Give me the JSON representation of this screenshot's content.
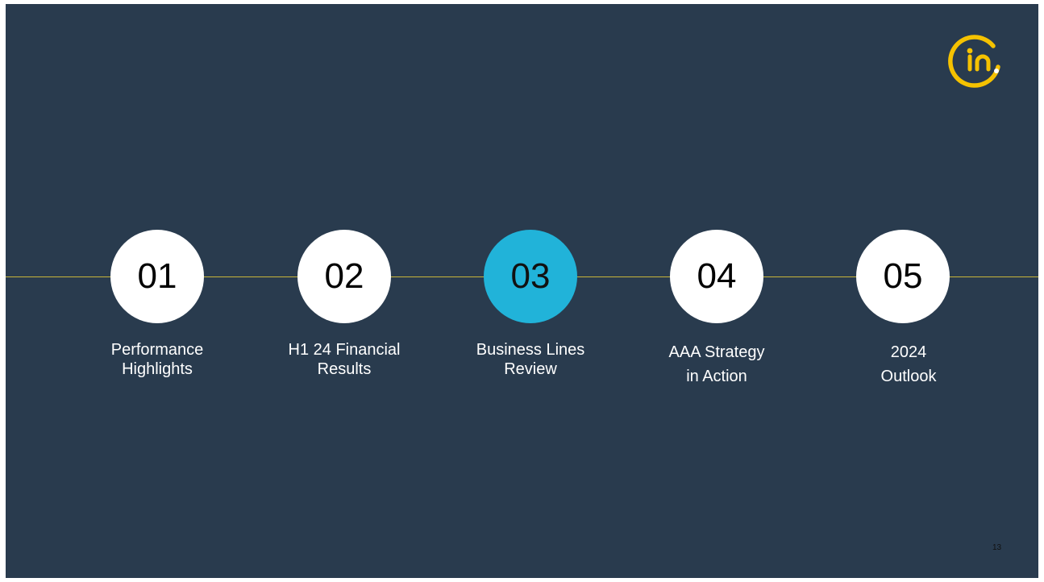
{
  "slide": {
    "page_number": "13",
    "logo_icon": "in-circle-logo",
    "colors": {
      "background": "#293b4e",
      "timeline": "#c7b43a",
      "active_circle": "#21b3d9",
      "logo": "#f5c200"
    }
  },
  "agenda": [
    {
      "number": "01",
      "label_line1": "Performance",
      "label_line2": "Highlights",
      "active": false
    },
    {
      "number": "02",
      "label_line1": "H1 24 Financial",
      "label_line2": "Results",
      "active": false
    },
    {
      "number": "03",
      "label_line1": "Business Lines",
      "label_line2": "Review",
      "active": true
    },
    {
      "number": "04",
      "label_line1": "AAA Strategy",
      "label_line2": "in Action",
      "active": false
    },
    {
      "number": "05",
      "label_line1": "2024",
      "label_line2": "Outlook",
      "active": false
    }
  ]
}
